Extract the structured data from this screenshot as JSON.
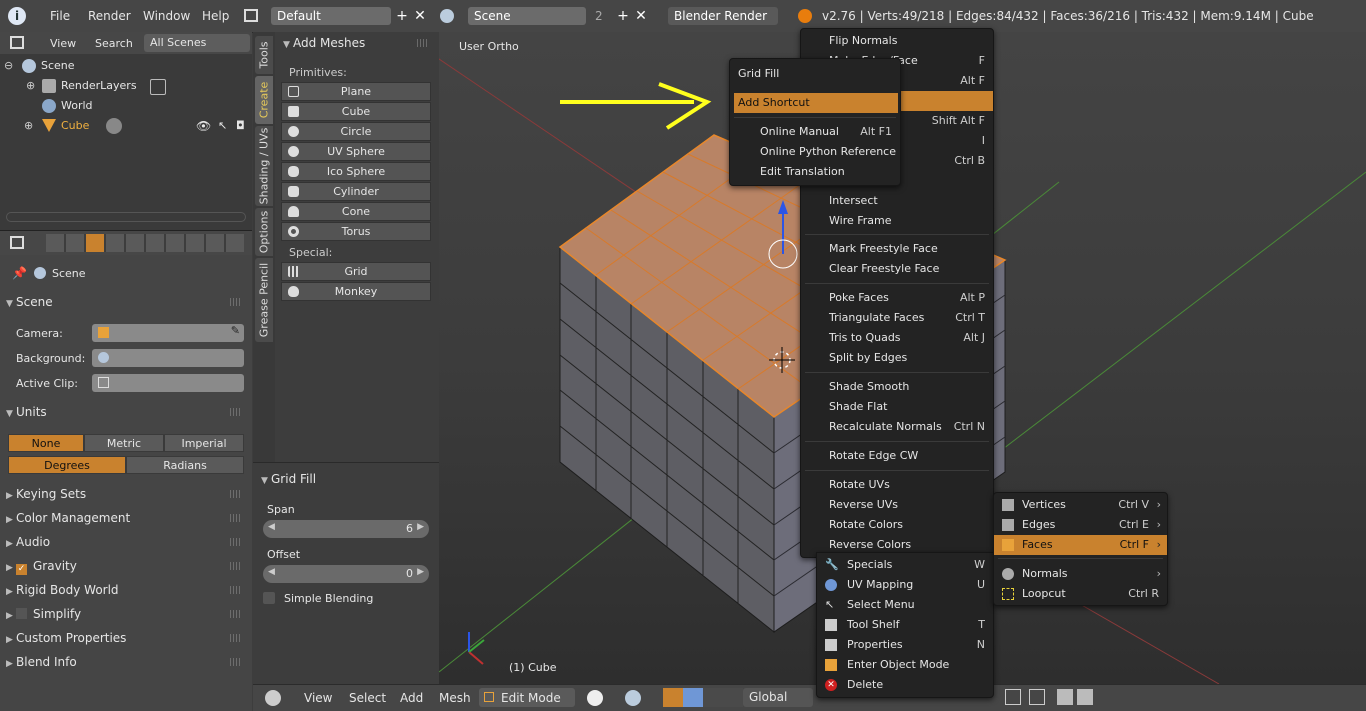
{
  "topbar": {
    "menus": [
      "File",
      "Render",
      "Window",
      "Help"
    ],
    "layout": "Default",
    "scene": "Scene",
    "scene_users": "2",
    "engine": "Blender Render",
    "stats": "v2.76 | Verts:49/218 | Edges:84/432 | Faces:36/216 | Tris:432 | Mem:9.14M | Cube"
  },
  "outliner": {
    "view": "View",
    "search": "Search",
    "filter": "All Scenes",
    "items": [
      "Scene",
      "RenderLayers",
      "World",
      "Cube"
    ]
  },
  "properties": {
    "context": "Scene",
    "scene_panel": "Scene",
    "camera_label": "Camera:",
    "background_label": "Background:",
    "active_clip_label": "Active Clip:",
    "units_panel": "Units",
    "unit_systems": [
      "None",
      "Metric",
      "Imperial"
    ],
    "rotation_units": [
      "Degrees",
      "Radians"
    ],
    "collapsed_panels": [
      "Keying Sets",
      "Color Management",
      "Audio",
      "Gravity",
      "Rigid Body World",
      "Simplify",
      "Custom Properties",
      "Blend Info"
    ]
  },
  "tool_tabs": [
    "Tools",
    "Create",
    "Shading / UVs",
    "Options",
    "Grease Pencil"
  ],
  "add_meshes": {
    "title": "Add Meshes",
    "primitives_label": "Primitives:",
    "primitives": [
      "Plane",
      "Cube",
      "Circle",
      "UV Sphere",
      "Ico Sphere",
      "Cylinder",
      "Cone",
      "Torus"
    ],
    "special_label": "Special:",
    "special": [
      "Grid",
      "Monkey"
    ]
  },
  "grid_fill": {
    "title": "Grid Fill",
    "span_label": "Span",
    "span_value": "6",
    "offset_label": "Offset",
    "offset_value": "0",
    "simple_blending": "Simple Blending"
  },
  "viewport": {
    "view_label": "User Ortho",
    "object_label": "(1) Cube"
  },
  "bottombar": {
    "view": "View",
    "select": "Select",
    "add": "Add",
    "mesh": "Mesh",
    "mode": "Edit Mode",
    "orientation": "Global"
  },
  "faces_menu": {
    "items": [
      {
        "label": "Flip Normals",
        "shortcut": ""
      },
      {
        "label": "Make Edge/Face",
        "shortcut": "F"
      },
      {
        "label": "",
        "shortcut": "Alt F"
      },
      {
        "label": "",
        "shortcut": ""
      },
      {
        "label": "",
        "shortcut": "Shift Alt F"
      },
      {
        "label": "",
        "shortcut": "I"
      },
      {
        "label": "",
        "shortcut": "Ctrl B"
      },
      {
        "label": "",
        "shortcut": ""
      },
      {
        "label": "Intersect",
        "shortcut": ""
      },
      {
        "label": "Wire Frame",
        "shortcut": ""
      },
      {
        "label": "Mark Freestyle Face",
        "shortcut": ""
      },
      {
        "label": "Clear Freestyle Face",
        "shortcut": ""
      },
      {
        "label": "Poke Faces",
        "shortcut": "Alt P"
      },
      {
        "label": "Triangulate Faces",
        "shortcut": "Ctrl T"
      },
      {
        "label": "Tris to Quads",
        "shortcut": "Alt J"
      },
      {
        "label": "Split by Edges",
        "shortcut": ""
      },
      {
        "label": "Shade Smooth",
        "shortcut": ""
      },
      {
        "label": "Shade Flat",
        "shortcut": ""
      },
      {
        "label": "Recalculate Normals",
        "shortcut": "Ctrl N"
      },
      {
        "label": "Rotate Edge CW",
        "shortcut": ""
      },
      {
        "label": "Rotate UVs",
        "shortcut": ""
      },
      {
        "label": "Reverse UVs",
        "shortcut": ""
      },
      {
        "label": "Rotate Colors",
        "shortcut": ""
      },
      {
        "label": "Reverse Colors",
        "shortcut": ""
      }
    ]
  },
  "context_menu": {
    "title": "Grid Fill",
    "items": [
      {
        "label": "Add Shortcut",
        "shortcut": ""
      },
      {
        "label": "Online Manual",
        "shortcut": "Alt F1"
      },
      {
        "label": "Online Python Reference",
        "shortcut": ""
      },
      {
        "label": "Edit Translation",
        "shortcut": ""
      }
    ]
  },
  "specials_menu": {
    "items": [
      {
        "label": "Specials",
        "shortcut": "W"
      },
      {
        "label": "UV Mapping",
        "shortcut": "U"
      },
      {
        "label": "Select Menu",
        "shortcut": ""
      },
      {
        "label": "Tool Shelf",
        "shortcut": "T"
      },
      {
        "label": "Properties",
        "shortcut": "N"
      },
      {
        "label": "Enter Object Mode",
        "shortcut": ""
      },
      {
        "label": "Delete",
        "shortcut": ""
      }
    ]
  },
  "mesh_select_menu": {
    "items": [
      {
        "label": "Vertices",
        "shortcut": "Ctrl V"
      },
      {
        "label": "Edges",
        "shortcut": "Ctrl E"
      },
      {
        "label": "Faces",
        "shortcut": "Ctrl F"
      },
      {
        "label": "Normals",
        "shortcut": ""
      },
      {
        "label": "Loopcut",
        "shortcut": "Ctrl R"
      }
    ]
  },
  "colors": {
    "accent": "#c9822e",
    "annotation_arrow": "#ffff1e",
    "face_select": "#b88465"
  }
}
